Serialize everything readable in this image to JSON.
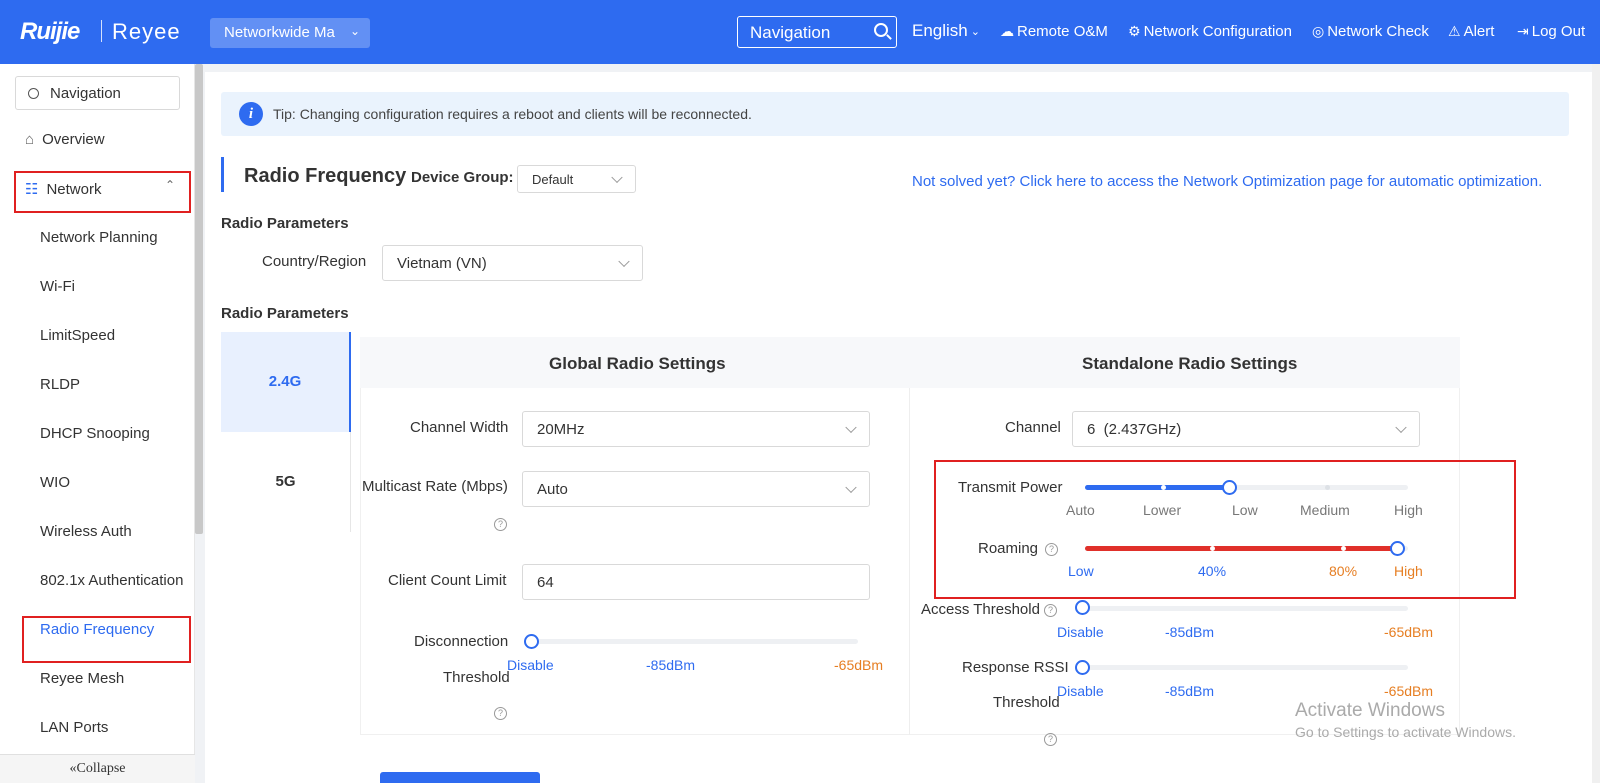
{
  "header": {
    "logo": "Ruijie",
    "logo2": "Reyee",
    "project": "Networkwide Ma",
    "nav_search": "Navigation",
    "language": "English",
    "items": [
      "Remote O&M",
      "Network Configuration",
      "Network Check",
      "Alert",
      "Log Out"
    ]
  },
  "sidebar": {
    "search": "Navigation",
    "overview": "Overview",
    "network": "Network",
    "items": [
      "Network Planning",
      "Wi-Fi",
      "LimitSpeed",
      "RLDP",
      "DHCP Snooping",
      "WIO",
      "Wireless Auth",
      "802.1x Authentication",
      "Radio Frequency",
      "Reyee Mesh",
      "LAN Ports"
    ],
    "collapse": "Collapse"
  },
  "main": {
    "tip": "Tip: Changing configuration requires a reboot and clients will be reconnected.",
    "title": "Radio Frequency",
    "device_group_label": "Device Group:",
    "device_group_value": "Default",
    "optimize_link": "Not solved yet? Click here to access the Network Optimization page for automatic optimization.",
    "radio_params_1": "Radio Parameters",
    "country_label": "Country/Region",
    "country_value": "Vietnam (VN)",
    "radio_params_2": "Radio Parameters",
    "tab_24": "2.4G",
    "tab_5": "5G",
    "global_head": "Global Radio Settings",
    "standalone_head": "Standalone Radio Settings",
    "channel_width_label": "Channel Width",
    "channel_width_value": "20MHz",
    "multicast_label": "Multicast Rate (Mbps)",
    "multicast_value": "Auto",
    "client_limit_label": "Client Count Limit",
    "client_limit_value": "64",
    "disconnect_label_1": "Disconnection",
    "disconnect_label_2": "Threshold",
    "disconnect_ticks": [
      "Disable",
      "-85dBm",
      "-65dBm"
    ],
    "channel_label": "Channel",
    "channel_value": "6  (2.437GHz)",
    "transmit_label": "Transmit Power",
    "transmit_ticks": [
      "Auto",
      "Lower",
      "Low",
      "Medium",
      "High"
    ],
    "transmit_level": 0.5,
    "roaming_label": "Roaming",
    "roaming_ticks": [
      "Low",
      "40%",
      "80%",
      "High"
    ],
    "roaming_level": 1.0,
    "access_label": "Access Threshold",
    "access_ticks": [
      "Disable",
      "-85dBm",
      "-65dBm"
    ],
    "response_label_1": "Response RSSI",
    "response_label_2": "Threshold",
    "response_ticks": [
      "Disable",
      "-85dBm",
      "-65dBm"
    ],
    "help_glyph": "?"
  },
  "watermark": {
    "line1": "Activate Windows",
    "line2": "Go to Settings to activate Windows."
  },
  "colors": {
    "primary": "#2e6bf0",
    "danger": "#e02020",
    "roaming_fill": "#e0302a",
    "warn_text": "#e67e22"
  }
}
